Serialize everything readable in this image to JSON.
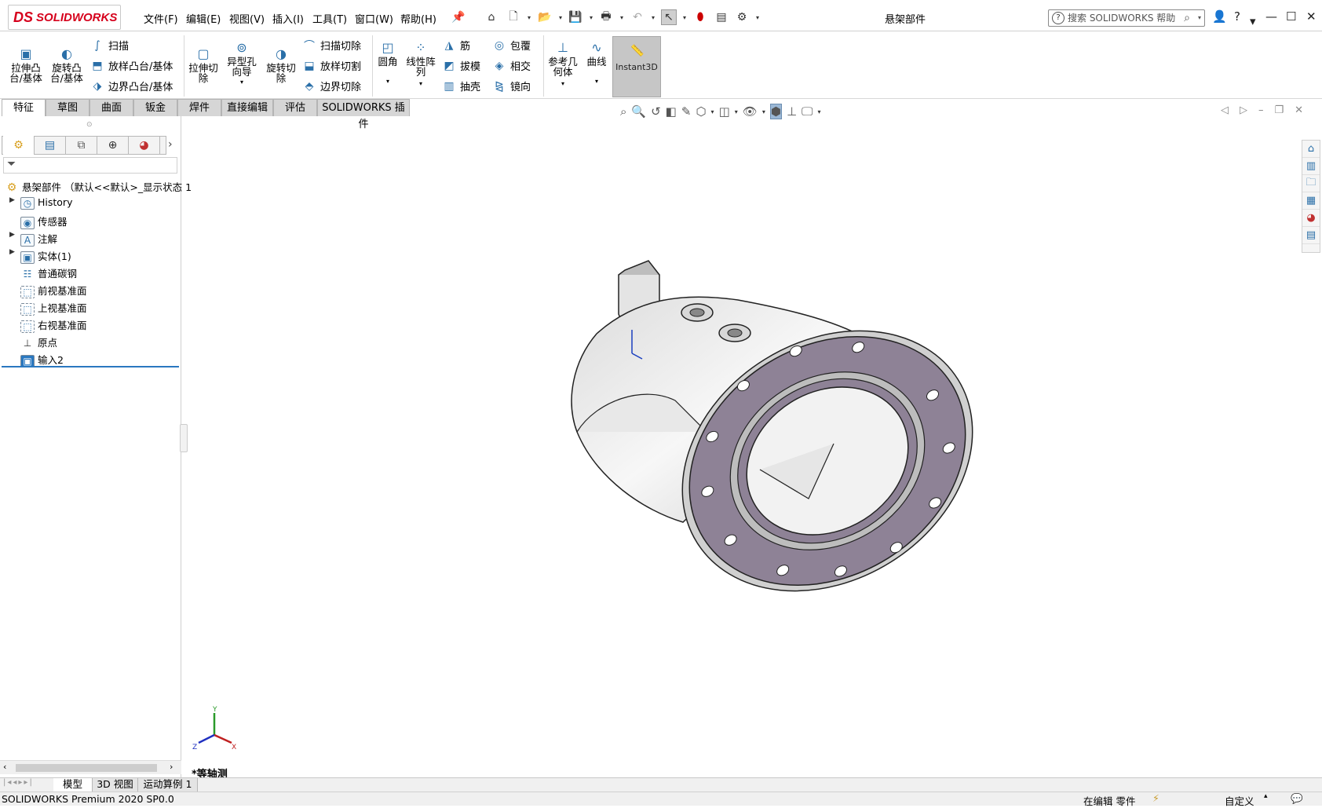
{
  "app": {
    "brand_ds": "DS",
    "brand_name": "SOLIDWORKS",
    "document_title": "悬架部件",
    "search_placeholder": "搜索 SOLIDWORKS 帮助"
  },
  "menu": [
    "文件(F)",
    "编辑(E)",
    "视图(V)",
    "插入(I)",
    "工具(T)",
    "窗口(W)",
    "帮助(H)"
  ],
  "ribbon": {
    "extrude_boss": "拉伸凸台/基体",
    "revolve_boss": "旋转凸台/基体",
    "sweep": "扫描",
    "loft_boss": "放样凸台/基体",
    "boundary_boss": "边界凸台/基体",
    "extrude_cut": "拉伸切除",
    "hole_wizard": "异型孔向导",
    "revolve_cut": "旋转切除",
    "swept_cut": "扫描切除",
    "lofted_cut": "放样切割",
    "boundary_cut": "边界切除",
    "fillet": "圆角",
    "linear_pattern": "线性阵列",
    "rib": "筋",
    "draft": "拔模",
    "shell": "抽壳",
    "wrap": "包覆",
    "intersect": "相交",
    "mirror": "镜向",
    "ref_geometry": "参考几何体",
    "curves": "曲线",
    "instant3d": "Instant3D"
  },
  "tabs": [
    "特征",
    "草图",
    "曲面",
    "钣金",
    "焊件",
    "直接编辑",
    "评估",
    "SOLIDWORKS 插件"
  ],
  "tree": {
    "root": "悬架部件 （默认<<默认>_显示状态 1",
    "items": [
      "History",
      "传感器",
      "注解",
      "实体(1)",
      "普通碳钢",
      "前视基准面",
      "上视基准面",
      "右视基准面",
      "原点",
      "输入2"
    ]
  },
  "viewport": {
    "view_label": "*等轴测",
    "triad_axes": [
      "Y",
      "Z",
      "X"
    ]
  },
  "bottom_tabs": [
    "模型",
    "3D 视图",
    "运动算例 1"
  ],
  "status": {
    "left": "SOLIDWORKS Premium 2020 SP0.0",
    "mode": "在编辑 零件",
    "units": "自定义"
  },
  "colors": {
    "brand_red": "#d6001c",
    "icon_blue": "#2a6fa8",
    "flange_face": "#8e8296",
    "body_light": "#efefef"
  }
}
